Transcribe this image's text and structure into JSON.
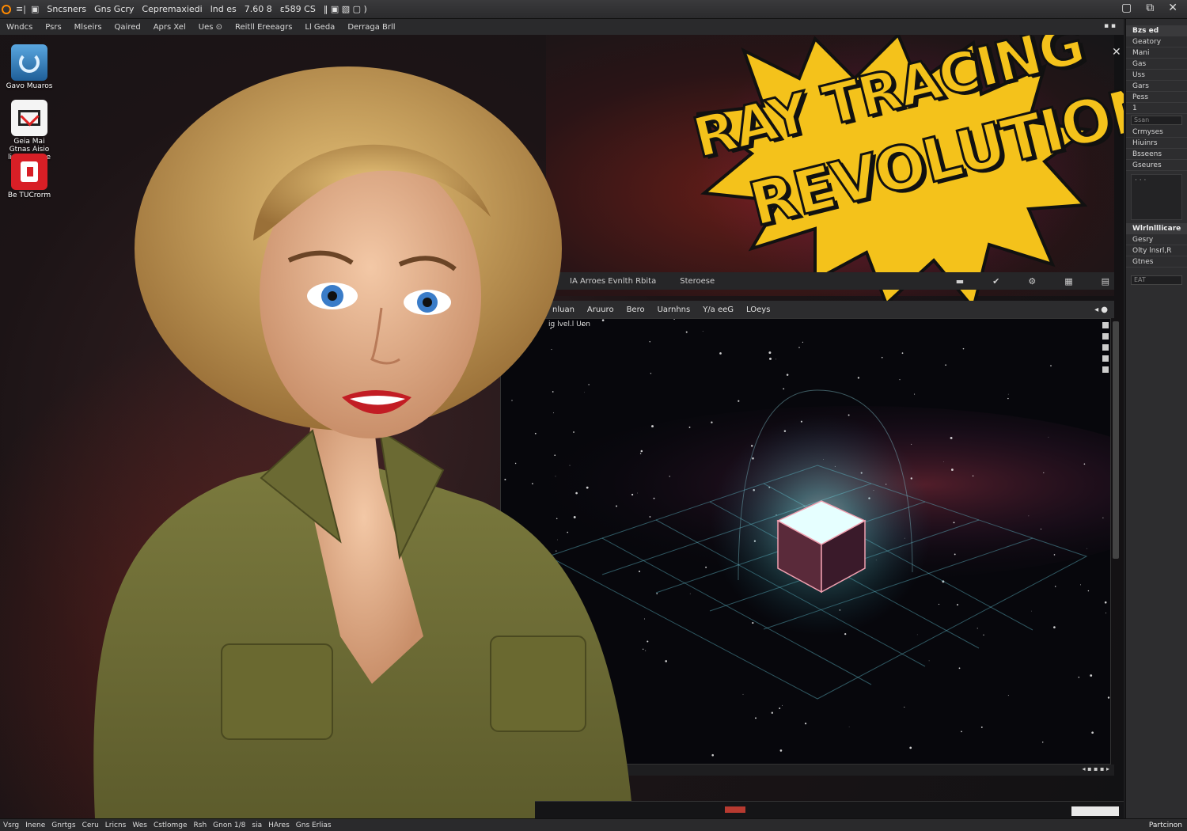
{
  "titlebar": {
    "items": [
      "Sncsners",
      "Gns Gcry",
      "Cepremaxiedi",
      "lnd es",
      "7.60 8",
      "ε589 CS"
    ],
    "icons": [
      "app-logo-icon",
      "menu-icon",
      "camera-icon"
    ],
    "controls": [
      "minimize-icon",
      "restore-icon",
      "close-icon"
    ]
  },
  "menubar": {
    "items": [
      "Wndcs",
      "Psrs",
      "Mlseirs",
      "Qaired",
      "Aprs Xel",
      "Ues ⊙",
      "Reitll Ereeagrs",
      "Ll Geda",
      "Derraga Brll"
    ],
    "right": "▪ ▪"
  },
  "desktop": {
    "icons": [
      {
        "label": "Gavo Muaros",
        "icon": "blue-ring-icon"
      },
      {
        "label": "Geia Mai Gtnas Aisio lican Mueoe",
        "icon": "mail-icon"
      },
      {
        "label": "Be TUCrorm",
        "icon": "red-app-icon"
      }
    ]
  },
  "banner": {
    "line1": "RAY TRACING",
    "line2": "REVOLUTION!",
    "color": "#f4c21b"
  },
  "upper_window": {
    "bar_items": [
      "IA   Arroes   Evnlth Rbita",
      "Steroese"
    ]
  },
  "viewport": {
    "toolbar": [
      "nluan",
      "Aruuro",
      "Bero",
      "Uarnhns",
      "Y/a eeG",
      "LOeys"
    ],
    "label": "ig lvel.l Uon"
  },
  "properties": {
    "header": "Bzs ed",
    "rows": [
      "Geatory",
      "Mani",
      "Gas",
      "Uss",
      "Gars",
      "Pess",
      "1"
    ],
    "field": "Ssan",
    "rows2": [
      "Crmyses",
      "Hiuinrs",
      "Bsseens",
      "Gseures"
    ],
    "box_text": "· · ·",
    "section2_header": "Wlrlnlllicare",
    "rows3": [
      "Gesry",
      "Olty lnsrl,R",
      "Gtnes"
    ],
    "field2": "EAT"
  },
  "statusbar": {
    "items": [
      "Vsrg",
      "Inene",
      "Gnrtgs",
      "Ceru",
      "Lricns",
      "Wes",
      "Cstlomge",
      "Rsh",
      "Gnon 1/8",
      "sia",
      "HAres",
      "Gns Erlias"
    ],
    "end": "Partcinon"
  }
}
